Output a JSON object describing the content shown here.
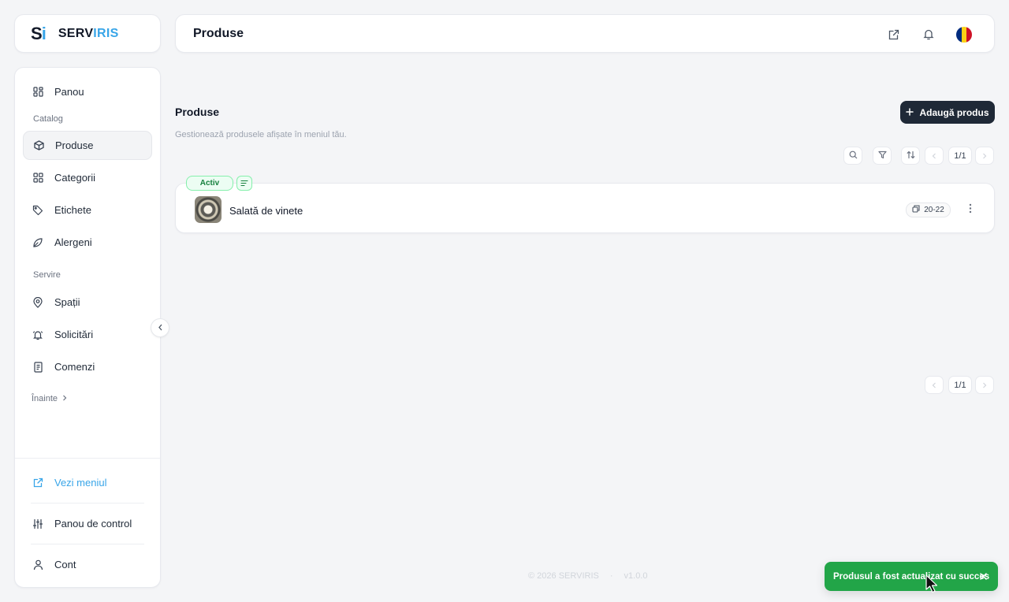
{
  "brand": {
    "mark_s": "S",
    "mark_i": "i",
    "name_a": "SERV",
    "name_b": "IRIS"
  },
  "header": {
    "title": "Produse"
  },
  "sidebar": {
    "items": [
      {
        "label": "Panou",
        "icon": "grid-icon"
      },
      {
        "label": "Produse",
        "icon": "box-icon",
        "active": true
      },
      {
        "label": "Categorii",
        "icon": "grid-icon"
      },
      {
        "label": "Etichete",
        "icon": "tag-icon"
      },
      {
        "label": "Alergeni",
        "icon": "leaf-icon"
      },
      {
        "label": "Spații",
        "icon": "map-pin-icon"
      },
      {
        "label": "Solicitări",
        "icon": "bell-ring-icon"
      },
      {
        "label": "Comenzi",
        "icon": "receipt-icon"
      }
    ],
    "sections": {
      "catalog": "Catalog",
      "servire": "Servire"
    },
    "more_label": "Înainte",
    "bottom": {
      "view_menu": "Vezi meniul",
      "control_panel": "Panou de control",
      "account": "Cont"
    }
  },
  "main": {
    "title": "Produse",
    "subtitle": "Gestionează produsele afișate în meniul tău.",
    "add_button": "Adaugă produs",
    "pager_top": "1/1",
    "pager_bottom": "1/1",
    "products": [
      {
        "status": "Activ",
        "name": "Salată de vinete",
        "time": "20-22"
      }
    ]
  },
  "footer": {
    "copyright": "© 2026 SERVIRIS",
    "separator": "·",
    "version": "v1.0.0"
  },
  "toast": {
    "message": "Produsul a fost actualizat cu succes"
  },
  "colors": {
    "accent": "#38a5e8",
    "dark": "#1f2937",
    "success": "#22a548"
  }
}
